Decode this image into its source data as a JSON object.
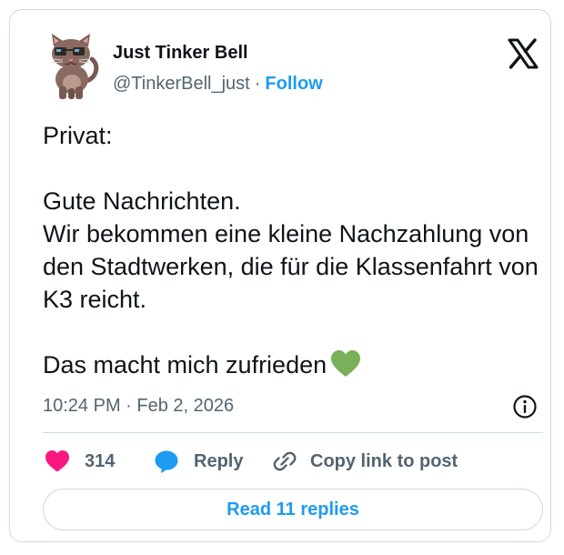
{
  "author": {
    "name": "Just Tinker Bell",
    "handle": "@TinkerBell_just",
    "separator": "·",
    "follow_label": "Follow",
    "avatar_icon": "cat-avatar-icon"
  },
  "platform": {
    "logo_icon": "x-logo-icon"
  },
  "tweet": {
    "text": "Privat:\n\nGute Nachrichten.\nWir bekommen eine kleine Nachzahlung von den Stadtwerken, die für die Klassenfahrt von K3 reicht.\n\nDas macht mich zufrieden",
    "emoji": "green-heart-icon",
    "timestamp": "10:24 PM · Feb 2, 2026"
  },
  "actions": {
    "like_count": "314",
    "reply_label": "Reply",
    "copy_link_label": "Copy link to post"
  },
  "read_replies_label": "Read 11 replies",
  "colors": {
    "accent": "#1d9bf0",
    "like": "#f91880",
    "secondary_text": "#536471",
    "heart_emoji": "#78b159"
  }
}
